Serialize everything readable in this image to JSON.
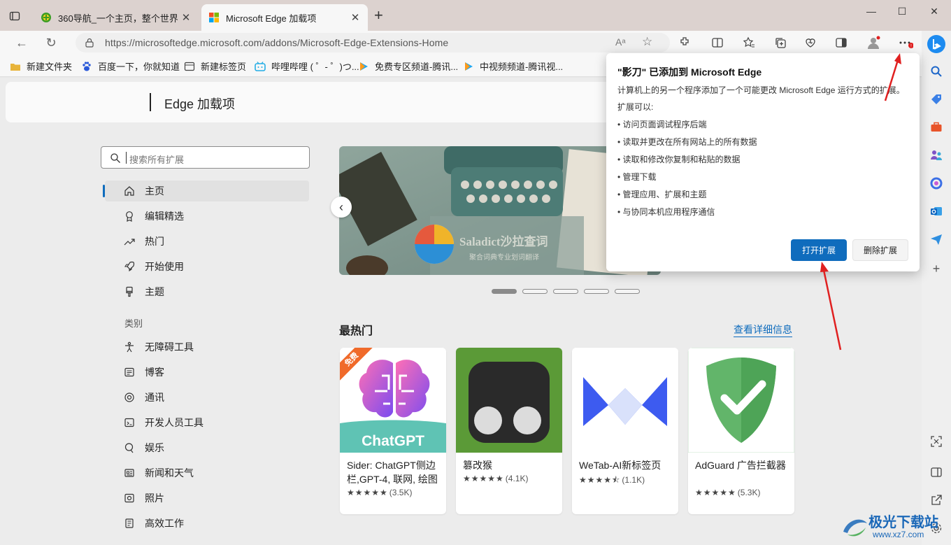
{
  "tabs": [
    {
      "title": "360导航_一个主页，整个世界"
    },
    {
      "title": "Microsoft Edge 加载项"
    }
  ],
  "address": {
    "url": "https://microsoftedge.microsoft.com/addons/Microsoft-Edge-Extensions-Home"
  },
  "favorites": [
    {
      "label": "新建文件夹",
      "icon": "folder-icon"
    },
    {
      "label": "百度一下，你就知道",
      "icon": "baidu-paw-icon"
    },
    {
      "label": "新建标签页",
      "icon": "newtab-page-icon"
    },
    {
      "label": "哔哩哔哩 ( ゜- ゜)つ...",
      "icon": "bilibili-icon"
    },
    {
      "label": "免费专区频道-腾讯...",
      "icon": "tencent-video-icon"
    },
    {
      "label": "中视频频道-腾讯视...",
      "icon": "tencent-video-icon"
    }
  ],
  "header": {
    "title": "Edge 加载项"
  },
  "search": {
    "placeholder": "搜索所有扩展"
  },
  "nav": {
    "items": [
      {
        "label": "主页",
        "icon": "home-icon"
      },
      {
        "label": "编辑精选",
        "icon": "award-icon"
      },
      {
        "label": "热门",
        "icon": "trending-icon"
      },
      {
        "label": "开始使用",
        "icon": "rocket-icon"
      },
      {
        "label": "主题",
        "icon": "brush-icon"
      }
    ],
    "category_label": "类别",
    "categories": [
      {
        "label": "无障碍工具",
        "icon": "accessibility-icon"
      },
      {
        "label": "博客",
        "icon": "blog-icon"
      },
      {
        "label": "通讯",
        "icon": "communication-icon"
      },
      {
        "label": "开发人员工具",
        "icon": "devtools-icon"
      },
      {
        "label": "娱乐",
        "icon": "entertainment-icon"
      },
      {
        "label": "新闻和天气",
        "icon": "news-icon"
      },
      {
        "label": "照片",
        "icon": "photo-icon"
      },
      {
        "label": "高效工作",
        "icon": "productivity-icon"
      }
    ]
  },
  "carousel": {
    "brand": "Saladict沙拉查词",
    "tagline": "聚合词典专业划词翻译"
  },
  "section": {
    "title": "最热门",
    "link": "查看详细信息"
  },
  "cards": [
    {
      "name": "Sider: ChatGPT侧边栏,GPT-4, 联网, 绘图",
      "stars": "★★★★★",
      "count": "(3.5K)",
      "badge": "免费",
      "thumb_text": "ChatGPT"
    },
    {
      "name": "篡改猴",
      "stars": "★★★★★",
      "count": "(4.1K)"
    },
    {
      "name": "WeTab-AI新标签页",
      "stars": "★★★★⯪",
      "count": "(1.1K)"
    },
    {
      "name": "AdGuard 广告拦截器",
      "stars": "★★★★★",
      "count": "(5.3K)"
    }
  ],
  "popup": {
    "title": "\"影刀\" 已添加到 Microsoft Edge",
    "description": "计算机上的另一个程序添加了一个可能更改 Microsoft Edge 运行方式的扩展。",
    "can_label": "扩展可以:",
    "permissions": [
      "• 访问页面调试程序后端",
      "• 读取并更改在所有网站上的所有数据",
      "• 读取和修改你复制和粘贴的数据",
      "• 管理下载",
      "• 管理应用、扩展和主题",
      "• 与协同本机应用程序通信"
    ],
    "open_button": "打开扩展",
    "remove_button": "删除扩展"
  },
  "watermark": {
    "text": "极光下载站",
    "url": "www.xz7.com"
  },
  "colors": {
    "accent": "#0f6cbd",
    "annotation_arrow": "#e02020",
    "tabbar": "#dcd2cf"
  }
}
